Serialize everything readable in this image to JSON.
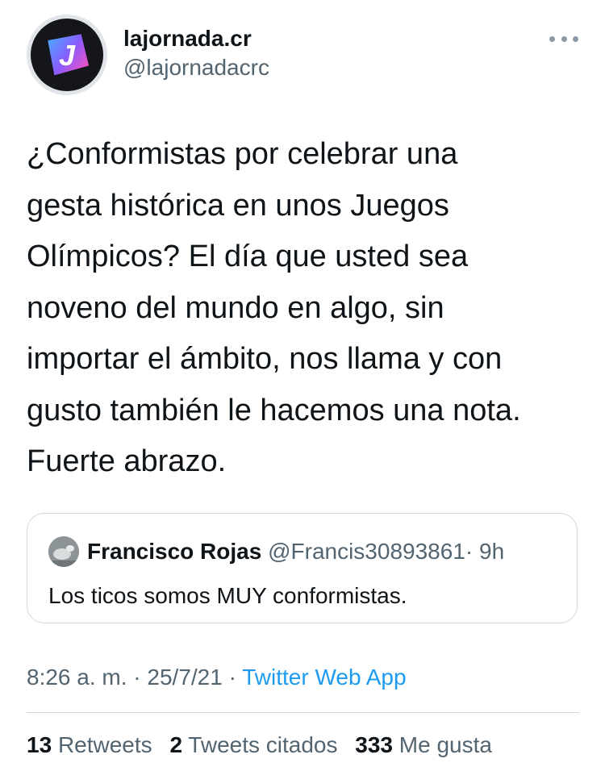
{
  "account": {
    "display_name": "lajornada.cr",
    "handle": "@lajornadacrc",
    "avatar_letter": "J"
  },
  "tweet": {
    "text": "¿Conformistas por celebrar una\ngesta histórica en unos Juegos\nOlímpicos? El día que usted sea\nnoveno del mundo en algo, sin\nimportar el ámbito, nos llama y con\ngusto también le hacemos una nota.\nFuerte abrazo."
  },
  "quoted_tweet": {
    "name": "Francisco Rojas",
    "handle": "@Francis30893861",
    "separator": "·",
    "age": "9h",
    "text": "Los ticos somos MUY conformistas."
  },
  "meta": {
    "time": "8:26 a. m.",
    "separator1": "·",
    "date": "25/7/21",
    "separator2": "·",
    "app": "Twitter Web App"
  },
  "stats": {
    "retweets_count": "13",
    "retweets_label": "Retweets",
    "quotes_count": "2",
    "quotes_label": "Tweets citados",
    "likes_count": "333",
    "likes_label": "Me gusta"
  },
  "colors": {
    "link": "#1d9bf0",
    "secondary_text": "#536471",
    "border": "#cfd9de"
  },
  "icons": {
    "more": "more-horizontal-icon"
  }
}
